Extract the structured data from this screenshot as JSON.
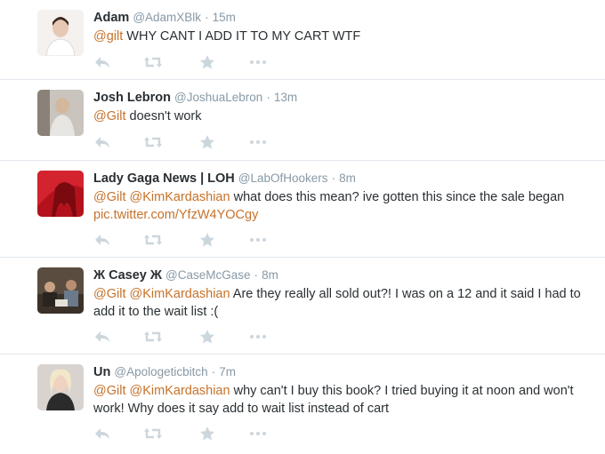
{
  "tweets": [
    {
      "fullname": "Adam",
      "username": "@AdamXBlk",
      "time": "15m",
      "parts": [
        {
          "text": "@gilt",
          "link": true
        },
        {
          "text": " WHY CANT I ADD IT TO MY CART WTF",
          "link": false
        }
      ]
    },
    {
      "fullname": "Josh Lebron",
      "username": "@JoshuaLebron",
      "time": "13m",
      "parts": [
        {
          "text": "@Gilt",
          "link": true
        },
        {
          "text": " doesn't work",
          "link": false
        }
      ]
    },
    {
      "fullname": "Lady Gaga News | LOH",
      "username": "@LabOfHookers",
      "time": "8m",
      "parts": [
        {
          "text": "@Gilt",
          "link": true
        },
        {
          "text": " ",
          "link": false
        },
        {
          "text": "@KimKardashian",
          "link": true
        },
        {
          "text": " what does this mean? ive gotten this since the sale began ",
          "link": false
        },
        {
          "text": "pic.twitter.com/YfzW4YOCgy",
          "link": true
        }
      ]
    },
    {
      "fullname": "Ж Casey Ж",
      "username": "@CaseMcGase",
      "time": "8m",
      "parts": [
        {
          "text": "@Gilt",
          "link": true
        },
        {
          "text": " ",
          "link": false
        },
        {
          "text": "@KimKardashian",
          "link": true
        },
        {
          "text": " Are they really all sold out?! I was on a 12 and it said I had to add it to the wait list :(",
          "link": false
        }
      ]
    },
    {
      "fullname": "Un",
      "username": "@Apologeticbitch",
      "time": "7m",
      "parts": [
        {
          "text": "@Gilt",
          "link": true
        },
        {
          "text": " ",
          "link": false
        },
        {
          "text": "@KimKardashian",
          "link": true
        },
        {
          "text": " why can't I buy this book? I tried buying it at noon and won't work! Why does it say add to wait list instead of cart",
          "link": false
        }
      ]
    }
  ],
  "separator": "·",
  "colors": {
    "link": "#c7722a",
    "meta": "#8899a6",
    "action_icon": "#ccd6dd",
    "divider": "#e1e8ed"
  },
  "actions": [
    "reply-icon",
    "retweet-icon",
    "favorite-icon",
    "more-icon"
  ]
}
